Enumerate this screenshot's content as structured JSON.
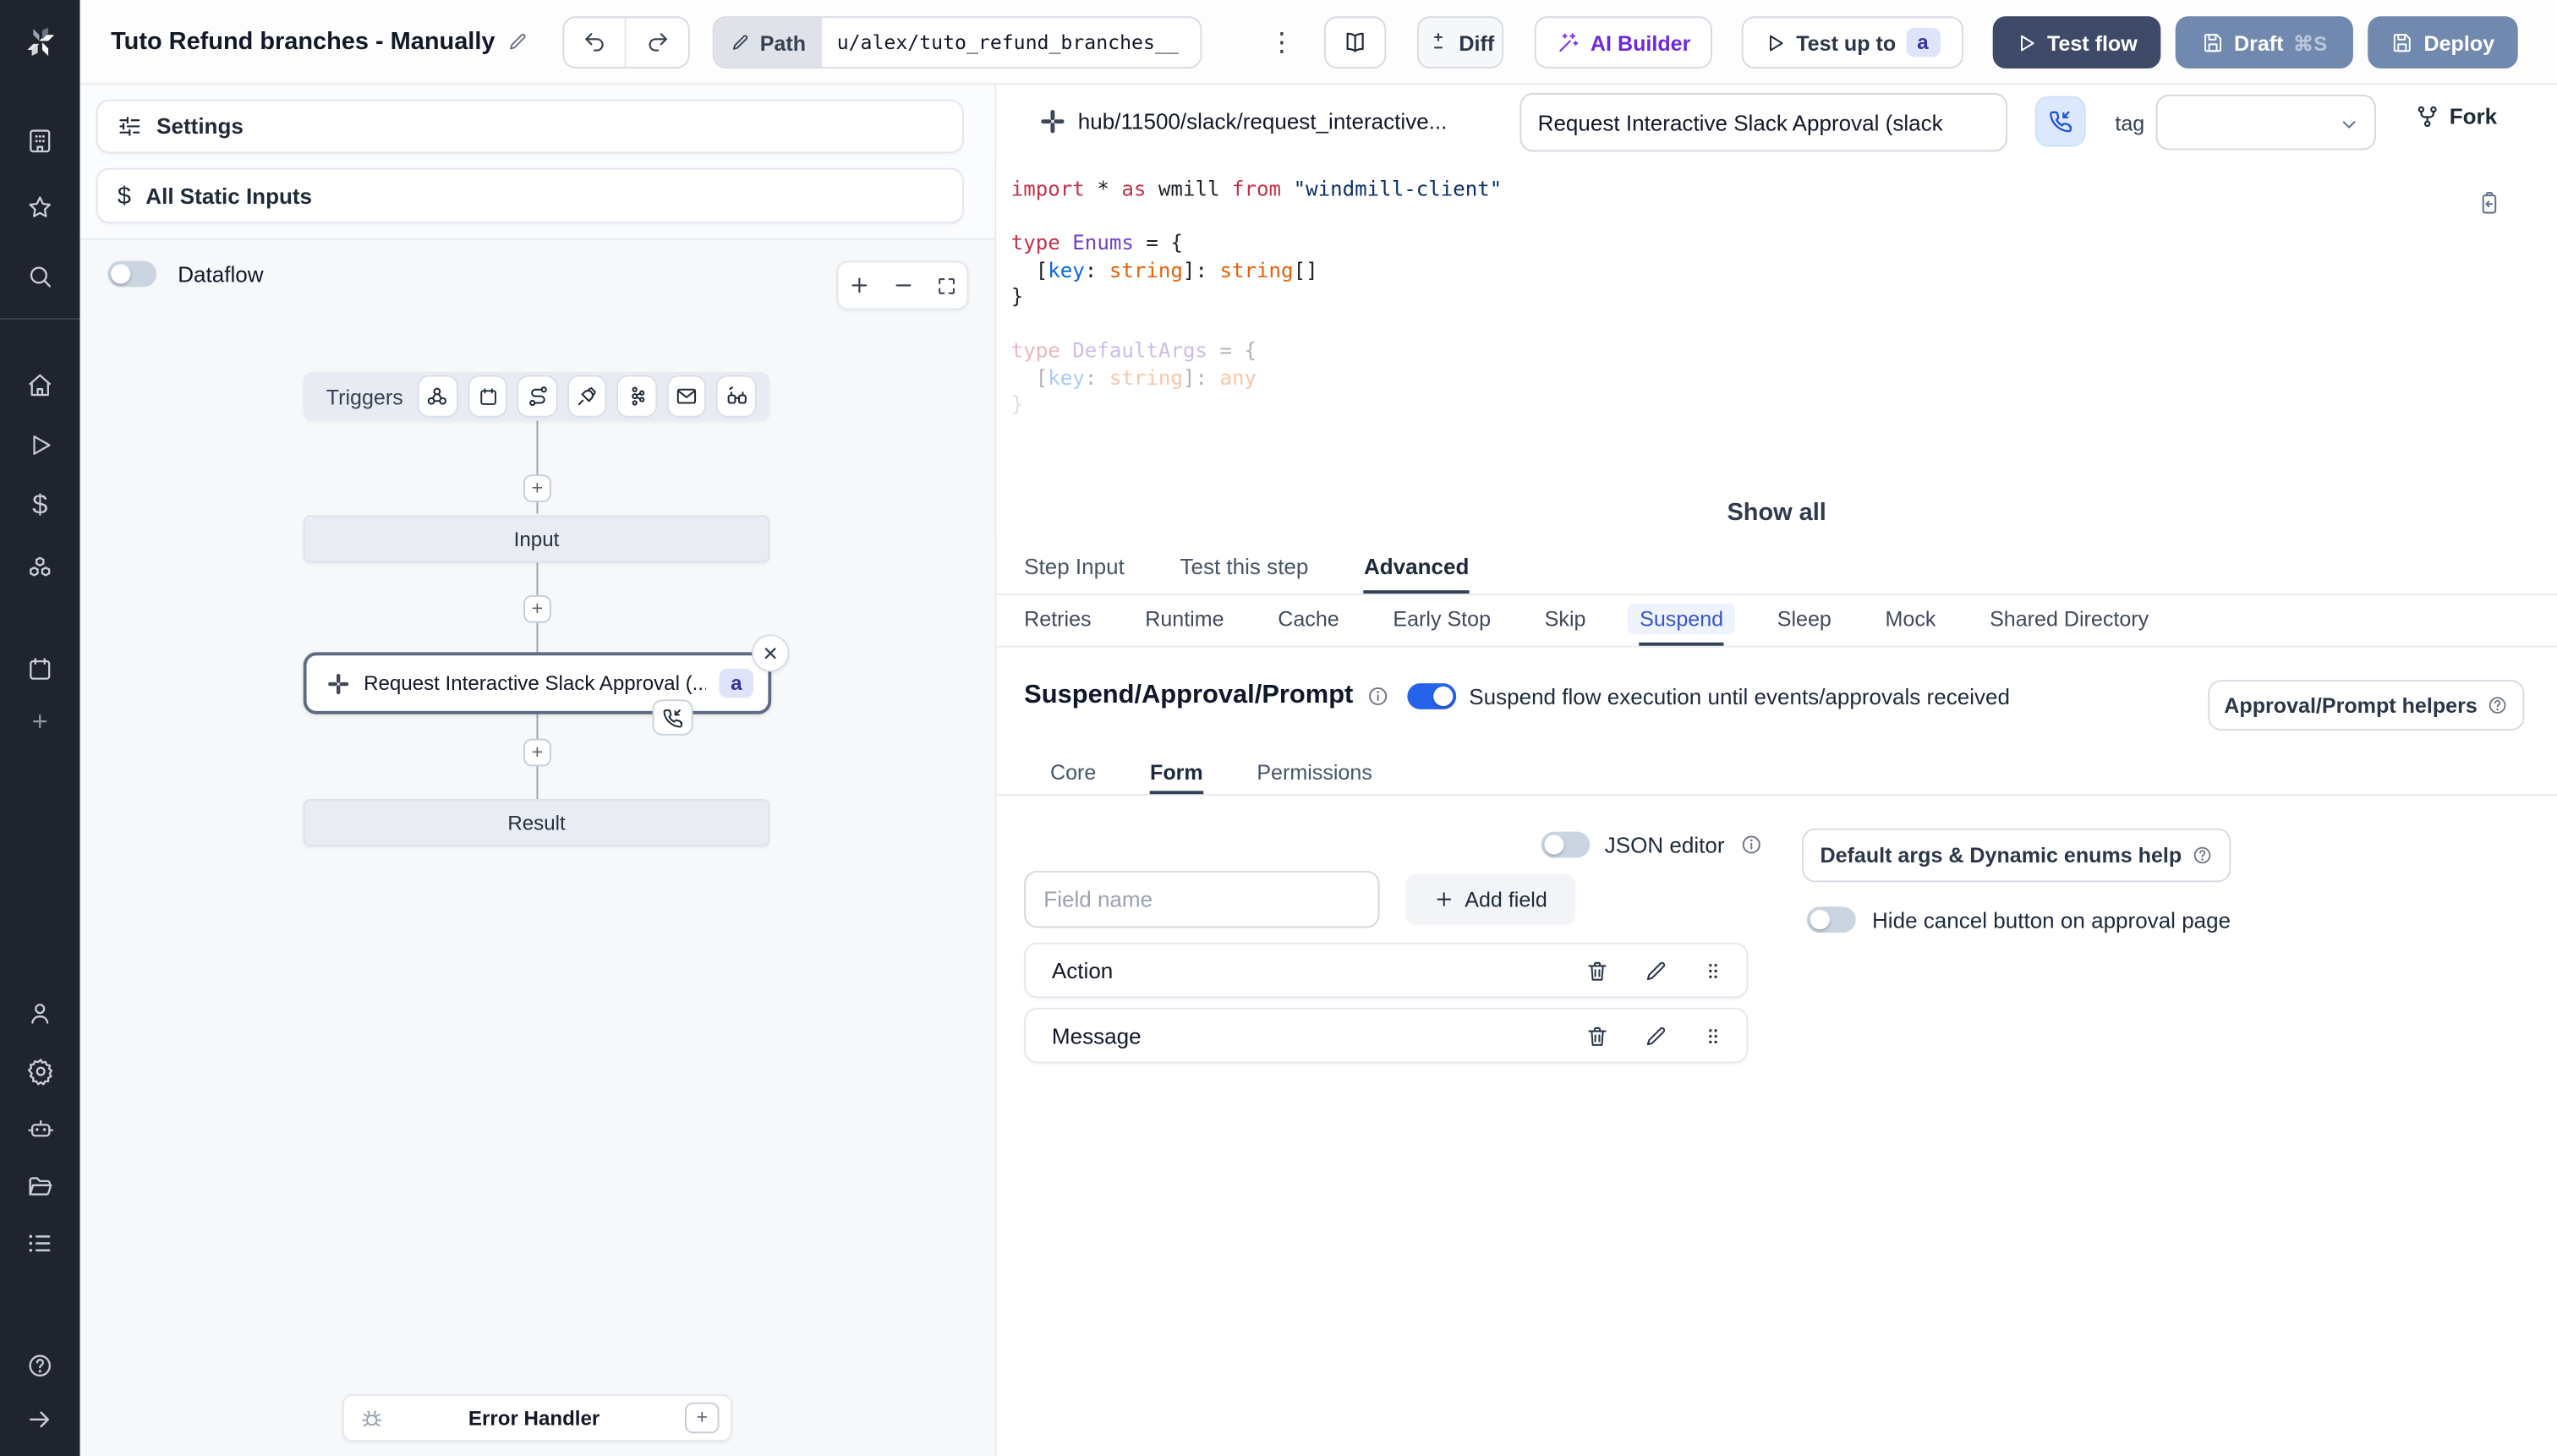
{
  "topbar": {
    "title": "Tuto Refund branches - Manually",
    "path_label": "Path",
    "path_value": "u/alex/tuto_refund_branches__",
    "diff_label": "Diff",
    "ai_builder_label": "AI Builder",
    "test_up_to_label": "Test up to",
    "test_up_to_badge": "a",
    "test_flow_label": "Test flow",
    "draft_label": "Draft",
    "draft_shortcut": "⌘S",
    "deploy_label": "Deploy"
  },
  "sidebar": {
    "icons": [
      "windmill-logo",
      "apps-icon",
      "star-icon",
      "search-icon",
      "home-icon",
      "runs-icon",
      "variables-icon",
      "resources-icon",
      "schedules-icon",
      "add-icon",
      "user-icon",
      "settings-icon",
      "workers-icon",
      "folders-icon",
      "logs-icon",
      "help-icon",
      "collapse-icon"
    ]
  },
  "flow": {
    "settings_label": "Settings",
    "static_inputs_label": "All Static Inputs",
    "dataflow_label": "Dataflow",
    "triggers_label": "Triggers",
    "trigger_icons": [
      "webhook-icon",
      "schedule-icon",
      "route-icon",
      "websocket-icon",
      "kafka-icon",
      "email-icon",
      "poll-icon"
    ],
    "input_node": "Input",
    "step_node_label": "Request Interactive Slack Approval (...",
    "step_node_badge": "a",
    "result_node": "Result",
    "error_handler_label": "Error Handler"
  },
  "panel": {
    "hub_path": "hub/11500/slack/request_interactive...",
    "name_value": "Request Interactive Slack Approval (slack",
    "tag_label": "tag",
    "fork_label": "Fork",
    "show_all": "Show all",
    "tabs": [
      "Step Input",
      "Test this step",
      "Advanced"
    ],
    "subtabs": [
      "Retries",
      "Runtime",
      "Cache",
      "Early Stop",
      "Skip",
      "Suspend",
      "Sleep",
      "Mock",
      "Shared Directory"
    ]
  },
  "code": {
    "line1": {
      "t1": "import",
      "t2": " * ",
      "t3": "as",
      "t4": " wmill ",
      "t5": "from",
      "t6": " \"windmill-client\""
    },
    "line3": {
      "t1": "type",
      "t2": " Enums",
      "t3": " = {"
    },
    "line4": {
      "t1": "  [",
      "t2": "key",
      "t3": ": ",
      "t4": "string",
      "t5": "]: ",
      "t6": "string",
      "t7": "[]"
    },
    "line5": "}",
    "line7": {
      "t1": "type",
      "t2": " DefaultArgs",
      "t3": " = {"
    },
    "line8": {
      "t1": "  [",
      "t2": "key",
      "t3": ": ",
      "t4": "string",
      "t5": "]: ",
      "t6": "any"
    },
    "line9": "}"
  },
  "suspend": {
    "heading": "Suspend/Approval/Prompt",
    "toggle_text": "Suspend flow execution until events/approvals received",
    "helpers_label": "Approval/Prompt helpers",
    "tabs": [
      "Core",
      "Form",
      "Permissions"
    ]
  },
  "form": {
    "json_editor_label": "JSON editor",
    "field_placeholder": "Field name",
    "add_field_label": "Add field",
    "default_args_label": "Default args & Dynamic enums help",
    "hide_cancel_label": "Hide cancel button on approval page",
    "fields": [
      {
        "label": "Action"
      },
      {
        "label": "Message"
      }
    ]
  },
  "colors": {
    "accent_blue": "#2563eb",
    "dark_button": "#3e4a68",
    "slate_button": "#7189ae",
    "badge_bg": "#e0e4fb",
    "badge_text": "#3730a3",
    "active_subtab": "#3956c9",
    "sidebar_bg": "#20242e"
  }
}
